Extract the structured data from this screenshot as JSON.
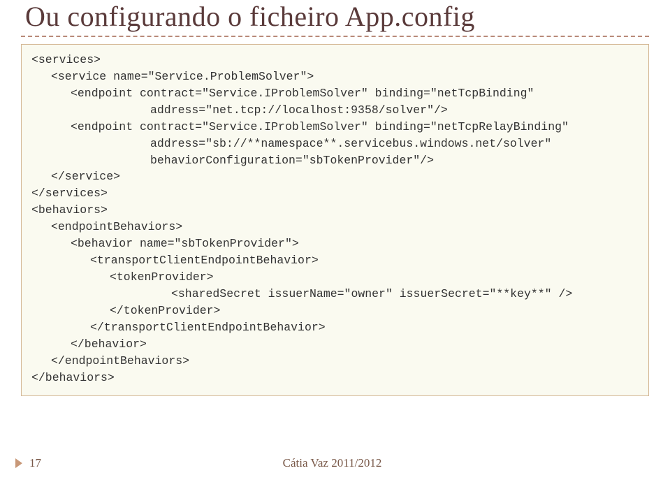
{
  "title": "Ou configurando o ficheiro App.config",
  "code": {
    "l0": "<services>",
    "l1": "<service name=\"Service.ProblemSolver\">",
    "l2": "<endpoint contract=\"Service.IProblemSolver\" binding=\"netTcpBinding\"",
    "l3": "address=\"net.tcp://localhost:9358/solver\"/>",
    "l4": "<endpoint contract=\"Service.IProblemSolver\" binding=\"netTcpRelayBinding\"",
    "l5": "address=\"sb://**namespace**.servicebus.windows.net/solver\"",
    "l6": "behaviorConfiguration=\"sbTokenProvider\"/>",
    "l7": "</service>",
    "l8": "</services>",
    "l9": "<behaviors>",
    "l10": "<endpointBehaviors>",
    "l11": "<behavior name=\"sbTokenProvider\">",
    "l12": "<transportClientEndpointBehavior>",
    "l13": "<tokenProvider>",
    "l14": "<sharedSecret issuerName=\"owner\" issuerSecret=\"**key**\" />",
    "l15": "</tokenProvider>",
    "l16": "</transportClientEndpointBehavior>",
    "l17": "</behavior>",
    "l18": "</endpointBehaviors>",
    "l19": "</behaviors>"
  },
  "footer": {
    "page": "17",
    "author": "Cátia Vaz 2011/2012"
  }
}
